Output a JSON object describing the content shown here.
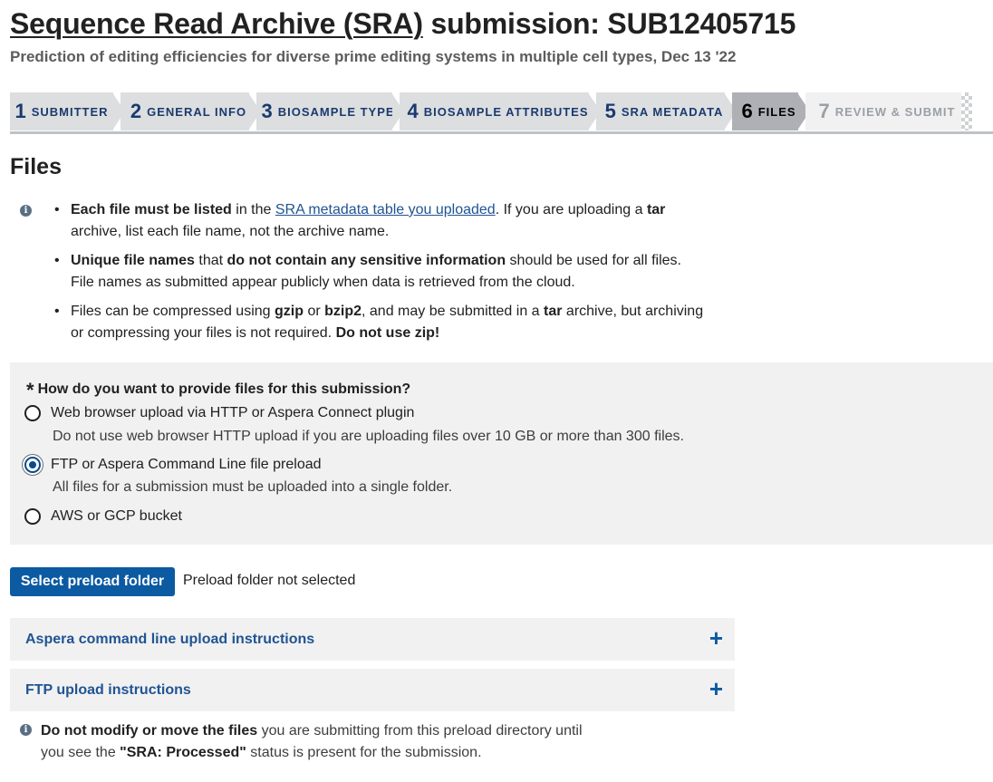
{
  "header": {
    "title_link": "Sequence Read Archive (SRA)",
    "title_rest": " submission: SUB12405715",
    "subtitle": "Prediction of editing efficiencies for diverse prime editing systems in multiple cell types, Dec 13 '22"
  },
  "steps": [
    {
      "num": "1",
      "label": "SUBMITTER",
      "state": "done"
    },
    {
      "num": "2",
      "label": "GENERAL INFO",
      "state": "done"
    },
    {
      "num": "3",
      "label": "BIOSAMPLE TYPE",
      "state": "done"
    },
    {
      "num": "4",
      "label": "BIOSAMPLE ATTRIBUTES",
      "state": "done"
    },
    {
      "num": "5",
      "label": "SRA METADATA",
      "state": "done"
    },
    {
      "num": "6",
      "label": "FILES",
      "state": "current"
    },
    {
      "num": "7",
      "label": "REVIEW & SUBMIT",
      "state": "disabled"
    }
  ],
  "section": {
    "title": "Files"
  },
  "info": {
    "b1_bold": "Each file must be listed",
    "b1_t1": " in the ",
    "b1_link": "SRA metadata table you uploaded",
    "b1_t2": ". If you are uploading a ",
    "b1_tar": "tar",
    "b1_t3": " archive, list each file name, not the archive name.",
    "b2_bold1": "Unique file names",
    "b2_t1": " that ",
    "b2_bold2": "do not contain any sensitive information",
    "b2_t2": " should be used for all files. File names as submitted appear publicly when data is retrieved from the cloud.",
    "b3_t1": "Files can be compressed using ",
    "b3_gzip": "gzip",
    "b3_t2": " or ",
    "b3_bzip2": "bzip2",
    "b3_t3": ", and may be submitted in a ",
    "b3_tar": "tar",
    "b3_t4": " archive, but archiving or compressing your files is not required. ",
    "b3_bold": "Do not use zip!"
  },
  "upload_method": {
    "required_mark": "*",
    "question": "How do you want to provide files for this submission?",
    "options": [
      {
        "label": "Web browser upload via HTTP or Aspera Connect plugin",
        "hint": "Do not use web browser HTTP upload if you are uploading files over 10 GB or more than 300 files.",
        "checked": false
      },
      {
        "label": "FTP or Aspera Command Line file preload",
        "hint": "All files for a submission must be uploaded into a single folder.",
        "checked": true
      },
      {
        "label": "AWS or GCP bucket",
        "hint": "",
        "checked": false
      }
    ]
  },
  "preload": {
    "button_label": "Select preload folder",
    "status": "Preload folder not selected"
  },
  "accordions": [
    {
      "label": "Aspera command line upload instructions",
      "icon": "plus-icon",
      "glyph": "+"
    },
    {
      "label": "FTP upload instructions",
      "icon": "plus-icon",
      "glyph": "+"
    }
  ],
  "note": {
    "bold1": "Do not modify or move the files",
    "t1": " you are submitting from this preload directory until you see the ",
    "bold2": "\"SRA: Processed\"",
    "t2": " status is present for the submission."
  },
  "colors": {
    "primary": "#0b5aa2",
    "link": "#205493",
    "step_text": "#1a3a6e",
    "step_bg": "#dcdee0",
    "step_current_bg": "#aeb0b5",
    "panel_bg": "#f1f1f1"
  }
}
